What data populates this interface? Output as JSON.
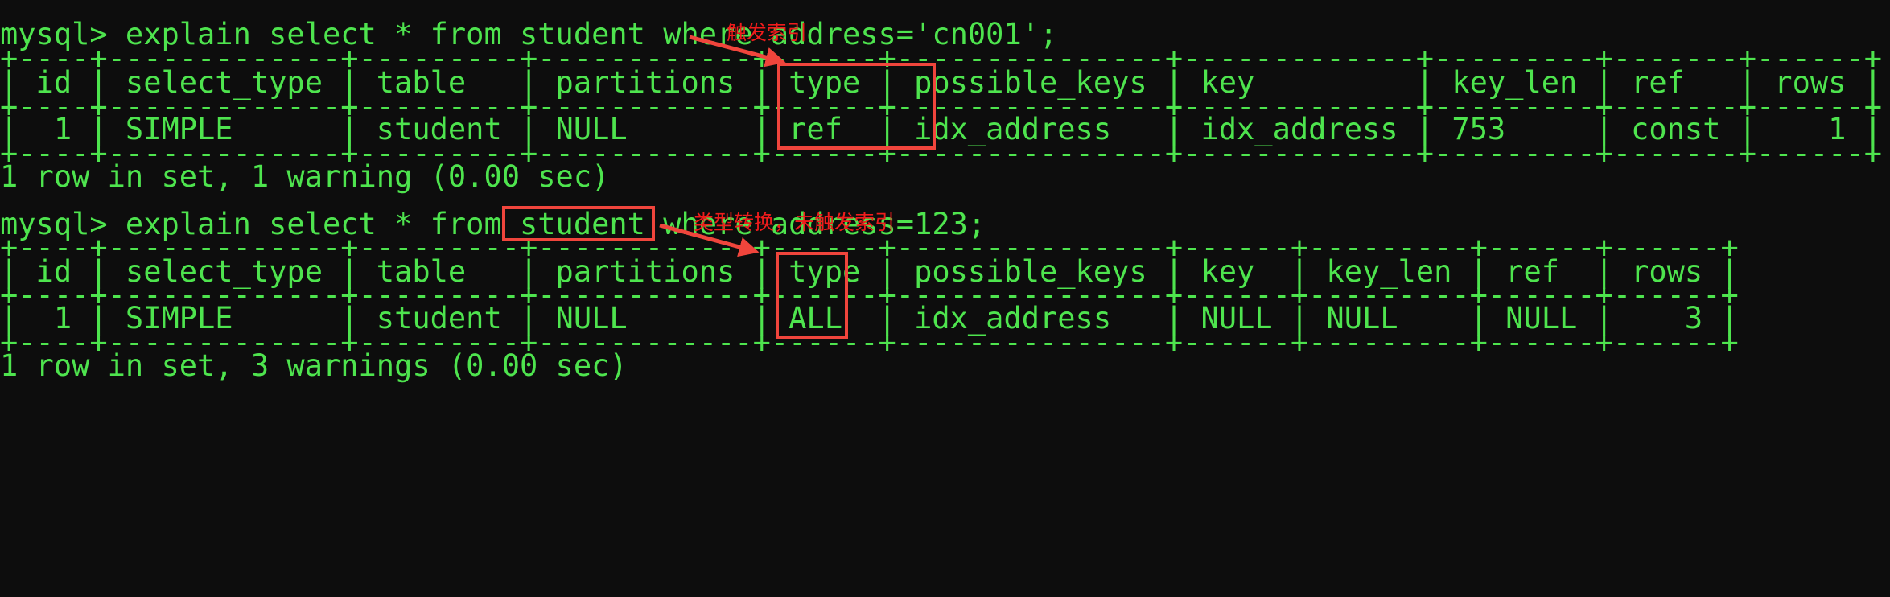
{
  "terminal": {
    "colors": {
      "background": "#0d0d0d",
      "text": "#4ee44e",
      "annotation": "#f01c1c",
      "highlight_box": "#f0453c"
    },
    "lines": [
      {
        "id": "prompt1",
        "text": "mysql> explain select * from student where address='cn001';"
      },
      {
        "id": "rule1a",
        "text": "+----+-------------+---------+------------+------+---------------+-------------+---------+-------+------+"
      },
      {
        "id": "header1",
        "text": "| id | select_type | table   | partitions | type | possible_keys | key         | key_len | ref   | rows |"
      },
      {
        "id": "rule1b",
        "text": "+----+-------------+---------+------------+------+---------------+-------------+---------+-------+------+"
      },
      {
        "id": "row1",
        "text": "|  1 | SIMPLE      | student | NULL       | ref  | idx_address   | idx_address | 753     | const |    1 |"
      },
      {
        "id": "rule1c",
        "text": "+----+-------------+---------+------------+------+---------------+-------------+---------+-------+------+"
      },
      {
        "id": "status1",
        "text": "1 row in set, 1 warning (0.00 sec)"
      },
      {
        "id": "prompt2",
        "text": "mysql> explain select * from student where address=123;"
      },
      {
        "id": "rule2a",
        "text": "+----+-------------+---------+------------+------+---------------+------+---------+------+------+"
      },
      {
        "id": "header2",
        "text": "| id | select_type | table   | partitions | type | possible_keys | key  | key_len | ref  | rows |"
      },
      {
        "id": "rule2b",
        "text": "+----+-------------+---------+------------+------+---------------+------+---------+------+------+"
      },
      {
        "id": "row2",
        "text": "|  1 | SIMPLE      | student | NULL       | ALL  | idx_address   | NULL | NULL    | NULL |    3 |"
      },
      {
        "id": "rule2c",
        "text": "+----+-------------+---------+------------+------+---------------+------+---------+------+------+"
      },
      {
        "id": "status2",
        "text": "1 row in set, 3 warnings (0.00 sec)"
      }
    ],
    "annotations": [
      {
        "id": "annot1",
        "text": "触发索引"
      },
      {
        "id": "annot2",
        "text": "类型转换，未触发索引"
      }
    ]
  },
  "queries": [
    {
      "prompt": "mysql>",
      "sql": "explain select * from student where address='cn001';",
      "explain_table": {
        "columns": [
          "id",
          "select_type",
          "table",
          "partitions",
          "type",
          "possible_keys",
          "key",
          "key_len",
          "ref",
          "rows"
        ],
        "rows": [
          [
            "1",
            "SIMPLE",
            "student",
            "NULL",
            "ref",
            "idx_address",
            "idx_address",
            "753",
            "const",
            "1"
          ]
        ]
      },
      "status": "1 row in set, 1 warning (0.00 sec)",
      "annotation": "触发索引",
      "highlighted_column": "key"
    },
    {
      "prompt": "mysql>",
      "sql": "explain select * from student where address=123;",
      "explain_table": {
        "columns": [
          "id",
          "select_type",
          "table",
          "partitions",
          "type",
          "possible_keys",
          "key",
          "key_len",
          "ref",
          "rows"
        ],
        "rows": [
          [
            "1",
            "SIMPLE",
            "student",
            "NULL",
            "ALL",
            "idx_address",
            "NULL",
            "NULL",
            "NULL",
            "3"
          ]
        ]
      },
      "status": "1 row in set, 3 warnings (0.00 sec)",
      "annotation": "类型转换，未触发索引",
      "highlighted_expression": "address=123;",
      "highlighted_column": "key"
    }
  ]
}
